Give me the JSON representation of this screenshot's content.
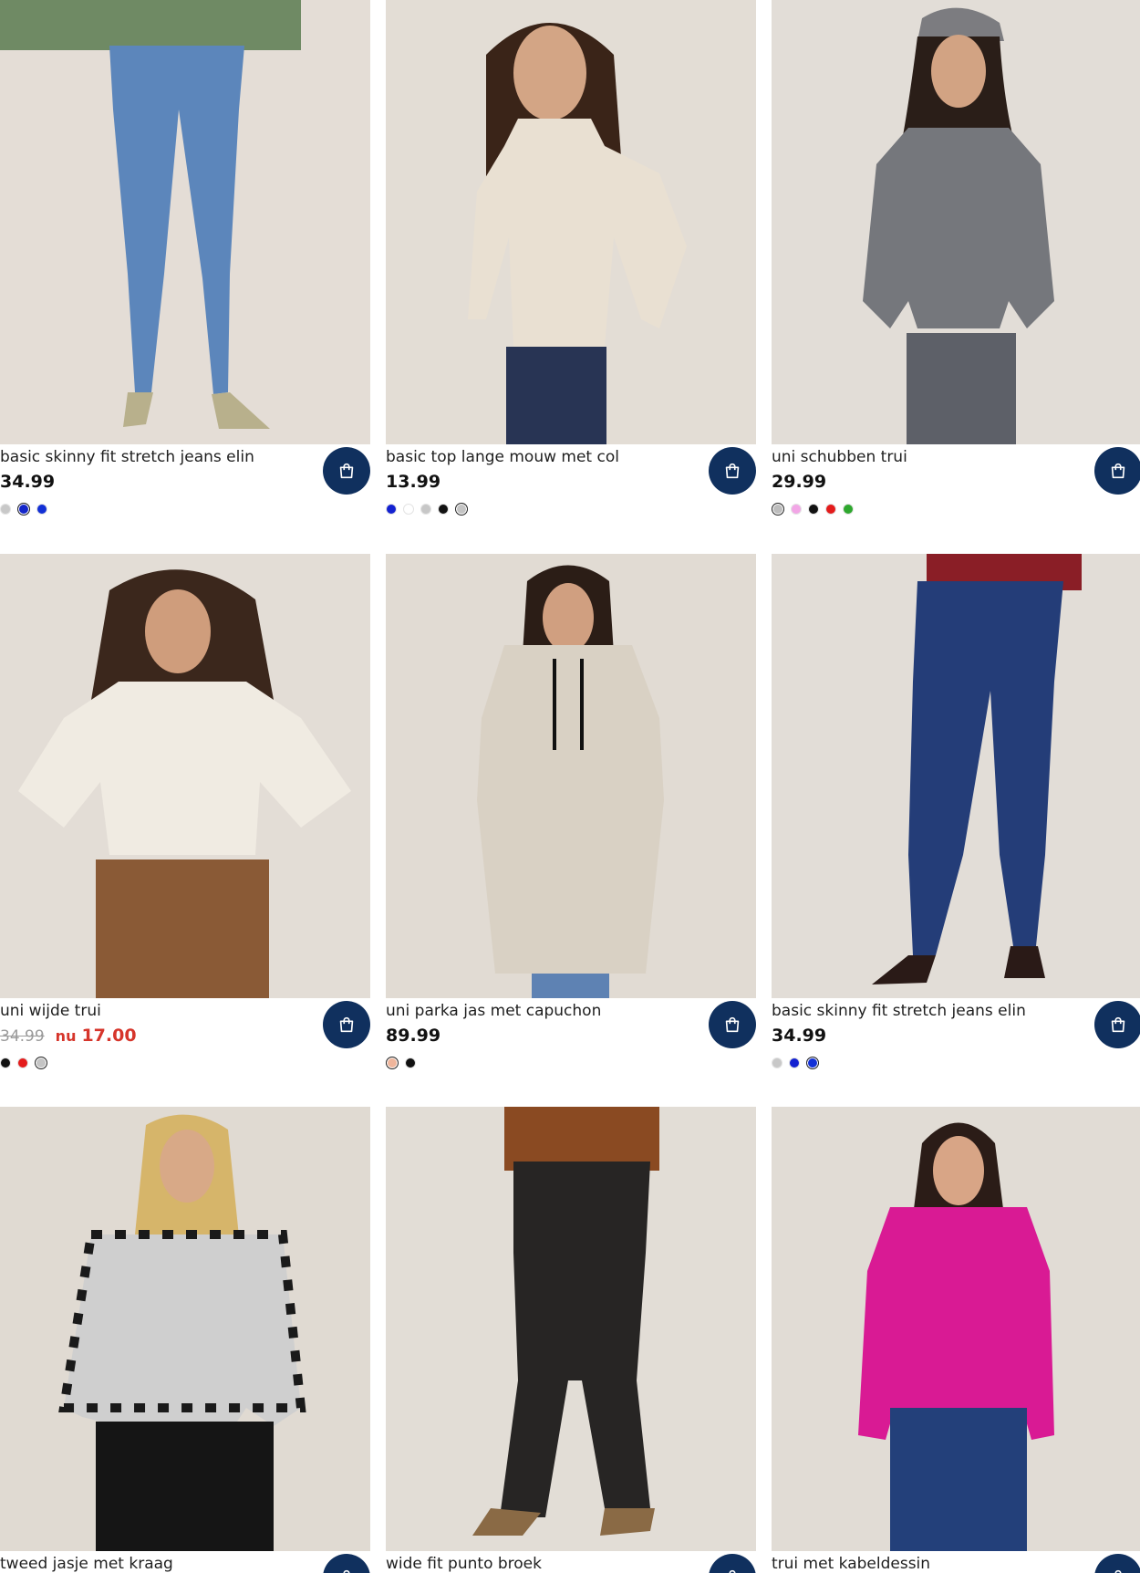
{
  "products": [
    {
      "title": "basic skinny fit stretch jeans elin",
      "price": "34.99",
      "swatches": [
        {
          "color": "#c8c8c8",
          "selected": false
        },
        {
          "color": "#1325c9",
          "selected": true
        },
        {
          "color": "#1230d6",
          "selected": false
        }
      ]
    },
    {
      "title": "basic top lange mouw met col",
      "price": "13.99",
      "swatches": [
        {
          "color": "#1321d1",
          "selected": false
        },
        {
          "color": "#ffffff",
          "selected": false
        },
        {
          "color": "#c7c7c7",
          "selected": false
        },
        {
          "color": "#111111",
          "selected": false
        },
        {
          "color": "#c4c4c4",
          "selected": true
        }
      ]
    },
    {
      "title": "uni schubben trui",
      "price": "29.99",
      "swatches": [
        {
          "color": "#bdbdbd",
          "selected": true
        },
        {
          "color": "#f2a6e6",
          "selected": false
        },
        {
          "color": "#111111",
          "selected": false
        },
        {
          "color": "#e41b1b",
          "selected": false
        },
        {
          "color": "#2ea82e",
          "selected": false
        }
      ]
    },
    {
      "title": "uni wijde trui",
      "old_price": "34.99",
      "sale_prefix": "nu",
      "sale_price": "17.00",
      "swatches": [
        {
          "color": "#111111",
          "selected": false
        },
        {
          "color": "#e41b1b",
          "selected": false
        },
        {
          "color": "#c4c4c4",
          "selected": true
        }
      ]
    },
    {
      "title": "uni parka jas met capuchon",
      "price": "89.99",
      "swatches": [
        {
          "color": "#efb59b",
          "selected": true
        },
        {
          "color": "#111111",
          "selected": false
        }
      ]
    },
    {
      "title": "basic skinny fit stretch jeans elin",
      "price": "34.99",
      "swatches": [
        {
          "color": "#c8c8c8",
          "selected": false
        },
        {
          "color": "#1321d1",
          "selected": false
        },
        {
          "color": "#1230d6",
          "selected": true
        }
      ]
    },
    {
      "title": "tweed jasje met kraag",
      "price": "",
      "swatches": []
    },
    {
      "title": "wide fit punto broek",
      "price": "",
      "swatches": []
    },
    {
      "title": "trui met kabeldessin",
      "price": "",
      "swatches": []
    }
  ],
  "colors": {
    "cart_button": "#10305e",
    "sale_red": "#d6352b",
    "photo_background": "#e6e1db"
  },
  "icons": {
    "cart": "shopping-bag-icon"
  }
}
